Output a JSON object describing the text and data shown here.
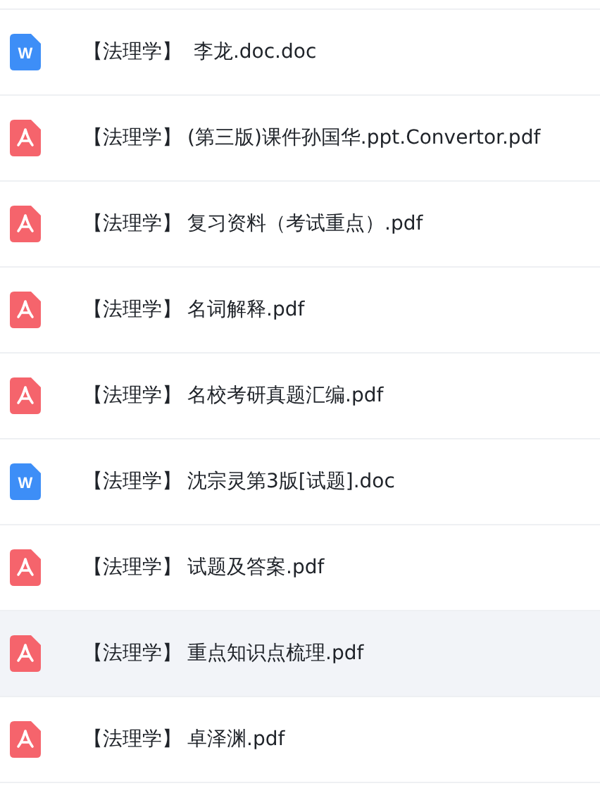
{
  "files": [
    {
      "kind": "doc",
      "icon_letter": "W",
      "tag": "【法理学】",
      "name": " 李龙.doc.doc",
      "selected": false
    },
    {
      "kind": "pdf",
      "tag": "【法理学】",
      "name": "(第三版)课件孙国华.ppt.Convertor.pdf",
      "selected": false
    },
    {
      "kind": "pdf",
      "tag": "【法理学】",
      "name": "复习资料（考试重点）.pdf",
      "selected": false
    },
    {
      "kind": "pdf",
      "tag": "【法理学】",
      "name": "名词解释.pdf",
      "selected": false
    },
    {
      "kind": "pdf",
      "tag": "【法理学】",
      "name": "名校考研真题汇编.pdf",
      "selected": false
    },
    {
      "kind": "doc",
      "icon_letter": "W",
      "tag": "【法理学】",
      "name": "沈宗灵第3版[试题].doc",
      "selected": false
    },
    {
      "kind": "pdf",
      "tag": "【法理学】",
      "name": "试题及答案.pdf",
      "selected": false
    },
    {
      "kind": "pdf",
      "tag": "【法理学】",
      "name": "重点知识点梳理.pdf",
      "selected": true
    },
    {
      "kind": "pdf",
      "tag": "【法理学】",
      "name": "卓泽渊.pdf",
      "selected": false
    }
  ]
}
